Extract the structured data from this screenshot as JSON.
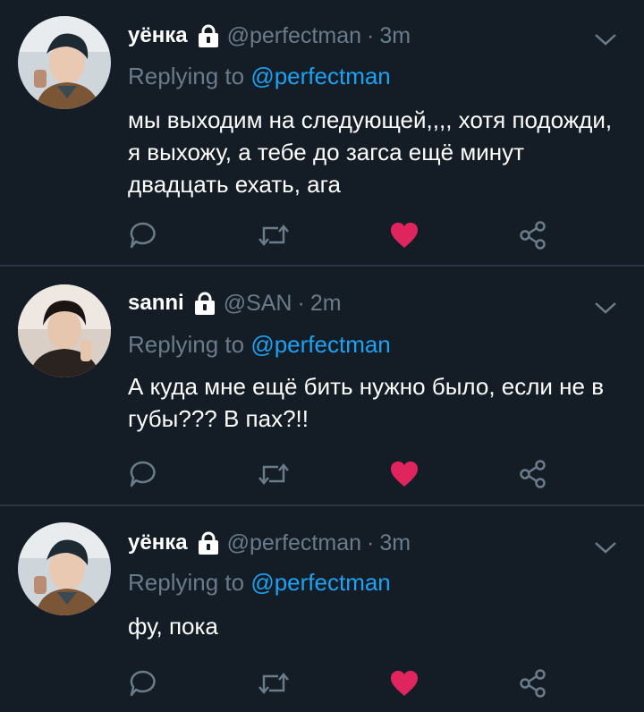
{
  "tweets": [
    {
      "name": "уёнка",
      "handle": "@perfectman",
      "separator": "·",
      "time": "3m",
      "reply_prefix": "Replying to",
      "reply_to": "@perfectman",
      "text": "мы выходим на следующей,,,, хотя подожди, я выхожу, а тебе до загса ещё минут двадцать ехать, ага",
      "liked": true
    },
    {
      "name": "sanni",
      "handle": "@SAN",
      "separator": "·",
      "time": "2m",
      "reply_prefix": "Replying to",
      "reply_to": "@perfectman",
      "text": "А куда мне ещё бить нужно было, если не в губы??? В пах?!!",
      "liked": true
    },
    {
      "name": "уёнка",
      "handle": "@perfectman",
      "separator": "·",
      "time": "3m",
      "reply_prefix": "Replying to",
      "reply_to": "@perfectman",
      "text": "фу, пока",
      "liked": true
    }
  ],
  "icons": {
    "lock": "lock-icon",
    "menu": "chevron-down-icon",
    "reply": "reply-icon",
    "retweet": "retweet-icon",
    "like": "heart-icon",
    "share": "share-icon"
  },
  "colors": {
    "background": "#141d26",
    "muted": "#6a7b8a",
    "link": "#1da1f2",
    "like": "#e0245e",
    "separator": "#2a3440"
  }
}
